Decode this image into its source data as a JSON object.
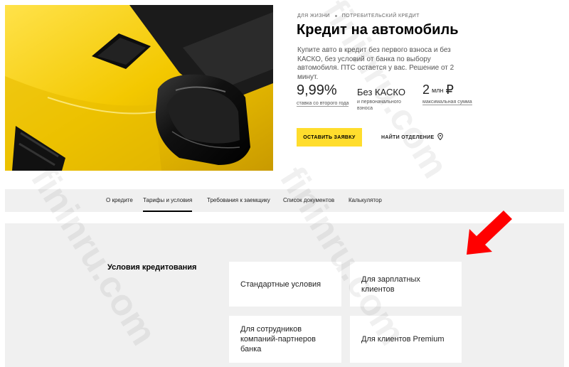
{
  "breadcrumbs": [
    "Для жизни",
    "Потребительский кредит"
  ],
  "title": "Кредит на автомобиль",
  "description": "Купите авто в кредит без первого взноса и без КАСКО, без условий от банка по выбору автомобиля. ПТС остается у вас. Решение от 2 минут.",
  "stats": [
    {
      "value": "9,99%",
      "label": "ставка со второго года"
    },
    {
      "value": "Без КАСКО",
      "label": "и первоначального взноса"
    },
    {
      "value_num": "2",
      "value_unit": "млн",
      "value_cur": "₽",
      "label": "максимальная сумма"
    }
  ],
  "buttons": {
    "apply": "Оставить заявку",
    "branch": "Найти отделение"
  },
  "nav": {
    "tabs": [
      "О кредите",
      "Тарифы и условия",
      "Требования к заемщику",
      "Список документов",
      "Калькулятор"
    ],
    "active_index": 1
  },
  "conditions": {
    "title": "Условия кредитования",
    "cards": [
      "Стандартные условия",
      "Для зарплатных клиентов",
      "Для сотрудников компаний-партнеров банка",
      "Для клиентов Premium"
    ]
  },
  "watermark": "fininru.com",
  "colors": {
    "accent": "#ffdd2d",
    "section_bg": "#f0f0f0",
    "arrow": "#ff0000"
  },
  "icons": {
    "branch": "location-pin-icon",
    "annotation": "red-arrow-icon"
  }
}
